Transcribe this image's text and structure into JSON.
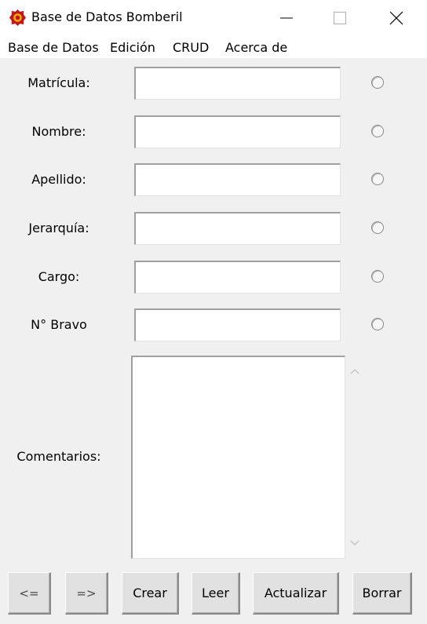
{
  "window": {
    "title": "Base de Datos Bomberil",
    "icon": "firefighter-emblem-icon",
    "controls": [
      "minimize-icon",
      "maximize-icon",
      "close-icon"
    ]
  },
  "menubar": {
    "items": [
      "Base de Datos",
      "Edición",
      "CRUD",
      "Acerca de"
    ]
  },
  "form": {
    "fields": [
      {
        "label": "Matrícula:",
        "value": ""
      },
      {
        "label": "Nombre:",
        "value": ""
      },
      {
        "label": "Apellido:",
        "value": ""
      },
      {
        "label": "Jerarquía:",
        "value": ""
      },
      {
        "label": "Cargo:",
        "value": ""
      },
      {
        "label": "N° Bravo",
        "value": ""
      }
    ],
    "comments": {
      "label": "Comentarios:",
      "value": ""
    }
  },
  "buttons": {
    "prev": "<=",
    "next": "=>",
    "create": "Crear",
    "read": "Leer",
    "update": "Actualizar",
    "delete": "Borrar"
  },
  "colors": {
    "background": "#f0f0f0",
    "icon_red": "#c4161c",
    "icon_gold": "#f2b705"
  }
}
